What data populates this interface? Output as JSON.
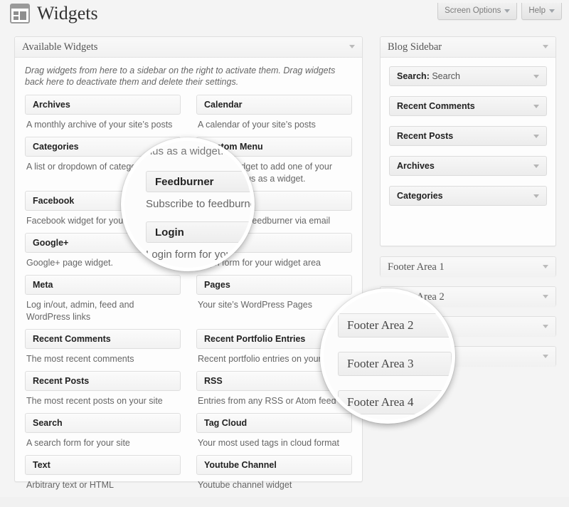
{
  "header": {
    "page_title": "Widgets",
    "icon": "widgets-icon",
    "screen_options_label": "Screen Options",
    "help_label": "Help"
  },
  "available_panel": {
    "title": "Available Widgets",
    "description": "Drag widgets from here to a sidebar on the right to activate them. Drag widgets back here to deactivate them and delete their settings.",
    "widgets": [
      {
        "name": "Archives",
        "description": "A monthly archive of your site’s posts"
      },
      {
        "name": "Calendar",
        "description": "A calendar of your site’s posts"
      },
      {
        "name": "Categories",
        "description": "A list or dropdown of categories"
      },
      {
        "name": "Custom Menu",
        "description": "Use this widget to add one of your custom menus as a widget."
      },
      {
        "name": "Facebook",
        "description": "Facebook widget for your widget area"
      },
      {
        "name": "Feedburner",
        "description": "Subscribe to feedburner via email"
      },
      {
        "name": "Google+",
        "description": "Google+ page widget."
      },
      {
        "name": "Login",
        "description": "Login form for your widget area"
      },
      {
        "name": "Meta",
        "description": "Log in/out, admin, feed and WordPress links"
      },
      {
        "name": "Pages",
        "description": "Your site’s WordPress Pages"
      },
      {
        "name": "Recent Comments",
        "description": "The most recent comments"
      },
      {
        "name": "Recent Portfolio Entries",
        "description": "Recent portfolio entries on your site"
      },
      {
        "name": "Recent Posts",
        "description": "The most recent posts on your site"
      },
      {
        "name": "RSS",
        "description": "Entries from any RSS or Atom feed"
      },
      {
        "name": "Search",
        "description": "A search form for your site"
      },
      {
        "name": "Tag Cloud",
        "description": "Your most used tags in cloud format"
      },
      {
        "name": "Text",
        "description": "Arbitrary text or HTML"
      },
      {
        "name": "Youtube Channel",
        "description": "Youtube channel widget"
      }
    ]
  },
  "blog_sidebar": {
    "title": "Blog Sidebar",
    "widgets": [
      {
        "label": "Search:",
        "value": "Search"
      },
      {
        "label": "Recent Comments",
        "value": ""
      },
      {
        "label": "Recent Posts",
        "value": ""
      },
      {
        "label": "Archives",
        "value": ""
      },
      {
        "label": "Categories",
        "value": ""
      }
    ]
  },
  "footer_areas": [
    {
      "title": "Footer Area 1"
    },
    {
      "title": "Footer Area 2"
    },
    {
      "title": "Footer Area 3"
    },
    {
      "title": "Footer Area 4"
    }
  ],
  "magnifiers": [
    {
      "id": "lens-widgets",
      "rows": [
        {
          "kind": "desc",
          "text": "menus as a widget."
        },
        {
          "kind": "bar",
          "text": "Feedburner"
        },
        {
          "kind": "desc",
          "text": "Subscribe to feedburner"
        },
        {
          "kind": "bar",
          "text": "Login"
        },
        {
          "kind": "desc",
          "text": "Login form for your wi"
        }
      ]
    },
    {
      "id": "lens-footers",
      "rows": [
        {
          "kind": "bar",
          "text": "Footer Area 2"
        },
        {
          "kind": "bar",
          "text": "Footer Area 3"
        },
        {
          "kind": "bar",
          "text": "Footer Area 4"
        }
      ]
    }
  ],
  "colors": {
    "page_background": "#f4f4f4",
    "panel_background": "#fdfdfd",
    "panel_border": "#dfdfdf",
    "text_primary": "#222222",
    "text_secondary": "#666666"
  }
}
